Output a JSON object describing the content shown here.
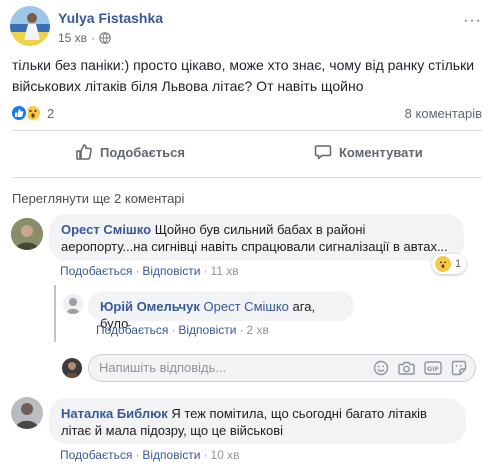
{
  "post": {
    "author": "Yulya Fistashka",
    "time": "15 хв",
    "text": "тільки без паніки:) просто цікаво, може хто знає, чому від ранку стільки військових літаків біля Львова літає? От навіть щойно",
    "reaction_count": "2",
    "comments_count": "8 коментарів"
  },
  "actions": {
    "like": "Подобається",
    "comment": "Коментувати"
  },
  "view_more": "Переглянути ще 2 коментарі",
  "comments": [
    {
      "author": "Орест Смішко",
      "text": "Щойно був сильний бабах в районі аеропорту...на сигнівці навіть спрацювали сигналізації в автах...",
      "like": "Подобається",
      "reply": "Відповісти",
      "time": "11 хв",
      "reaction_count": "1"
    },
    {
      "author": "Наталка Библюк",
      "text": "Я теж помітила, що сьогодні багато літаків літає й мала підозру, що це військові",
      "like": "Подобається",
      "reply": "Відповісти",
      "time": "10 хв"
    }
  ],
  "reply": {
    "author": "Юрій Омельчук",
    "mention": "Орест Смішко",
    "text": "ага, було",
    "like": "Подобається",
    "reply": "Відповісти",
    "time": "2 хв"
  },
  "reply_input": {
    "placeholder": "Напишіть відповідь..."
  },
  "colors": {
    "link": "#385898",
    "like_blue": "#1877f2",
    "wow_yellow": "#f7c948"
  }
}
